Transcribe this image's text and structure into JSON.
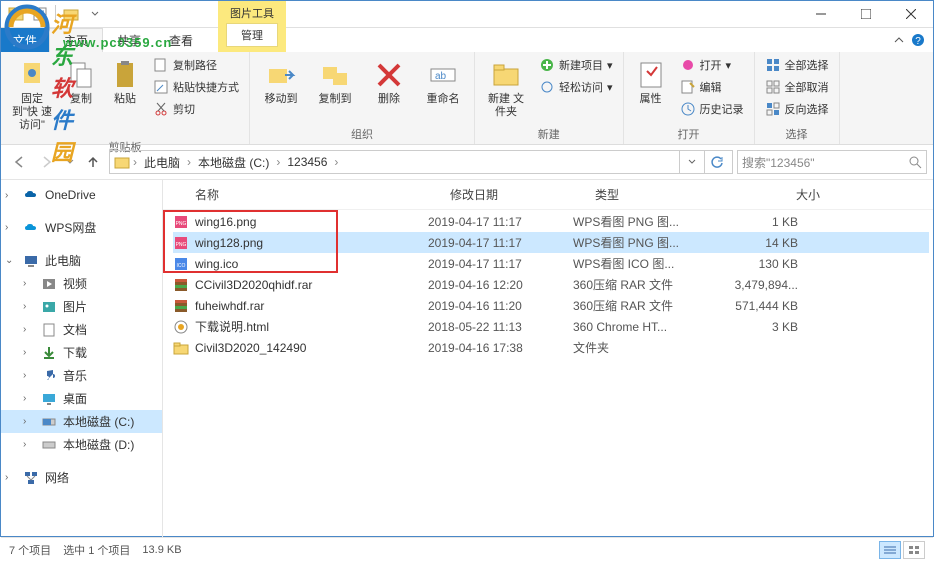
{
  "window": {
    "title": "123456"
  },
  "context_tab": {
    "group": "图片工具",
    "name": "管理"
  },
  "file_tab": "文件",
  "tabs": {
    "home": "主页",
    "share": "共享",
    "view": "查看"
  },
  "ribbon": {
    "clipboard": {
      "label": "剪贴板",
      "pin": "固定到\"快\n速访问\"",
      "copy": "复制",
      "paste": "粘贴",
      "copy_path": "复制路径",
      "paste_shortcut": "粘贴快捷方式",
      "cut": "剪切"
    },
    "organize": {
      "label": "组织",
      "move_to": "移动到",
      "copy_to": "复制到",
      "delete": "删除",
      "rename": "重命名"
    },
    "new": {
      "label": "新建",
      "new_folder": "新建\n文件夹",
      "new_item": "新建项目",
      "easy_access": "轻松访问"
    },
    "open": {
      "label": "打开",
      "properties": "属性",
      "open": "打开",
      "edit": "编辑",
      "history": "历史记录"
    },
    "select": {
      "label": "选择",
      "select_all": "全部选择",
      "select_none": "全部取消",
      "invert": "反向选择"
    }
  },
  "breadcrumb": {
    "this_pc": "此电脑",
    "drive": "本地磁盘 (C:)",
    "folder": "123456"
  },
  "search": {
    "placeholder": "搜索\"123456\""
  },
  "sidebar": {
    "onedrive": "OneDrive",
    "wps": "WPS网盘",
    "this_pc": "此电脑",
    "videos": "视频",
    "pictures": "图片",
    "documents": "文档",
    "downloads": "下载",
    "music": "音乐",
    "desktop": "桌面",
    "drive_c": "本地磁盘 (C:)",
    "drive_d": "本地磁盘 (D:)",
    "network": "网络"
  },
  "columns": {
    "name": "名称",
    "date": "修改日期",
    "type": "类型",
    "size": "大小"
  },
  "files": [
    {
      "name": "wing16.png",
      "date": "2019-04-17 11:17",
      "type": "WPS看图 PNG 图...",
      "size": "1 KB",
      "icon": "png"
    },
    {
      "name": "wing128.png",
      "date": "2019-04-17 11:17",
      "type": "WPS看图 PNG 图...",
      "size": "14 KB",
      "icon": "png",
      "selected": true
    },
    {
      "name": "wing.ico",
      "date": "2019-04-17 11:17",
      "type": "WPS看图 ICO 图...",
      "size": "130 KB",
      "icon": "ico"
    },
    {
      "name": "CCivil3D2020qhidf.rar",
      "date": "2019-04-16 12:20",
      "type": "360压缩 RAR 文件",
      "size": "3,479,894...",
      "icon": "rar"
    },
    {
      "name": "fuheiwhdf.rar",
      "date": "2019-04-16 11:20",
      "type": "360压缩 RAR 文件",
      "size": "571,444 KB",
      "icon": "rar"
    },
    {
      "name": "下载说明.html",
      "date": "2018-05-22 11:13",
      "type": "360 Chrome HT...",
      "size": "3 KB",
      "icon": "html"
    },
    {
      "name": "Civil3D2020_142490",
      "date": "2019-04-16 17:38",
      "type": "文件夹",
      "size": "",
      "icon": "folder"
    }
  ],
  "status": {
    "items": "7 个项目",
    "selected": "选中 1 个项目",
    "size": "13.9 KB"
  },
  "watermark": {
    "name": "河东软件园",
    "url": "www.pc0359.cn"
  }
}
